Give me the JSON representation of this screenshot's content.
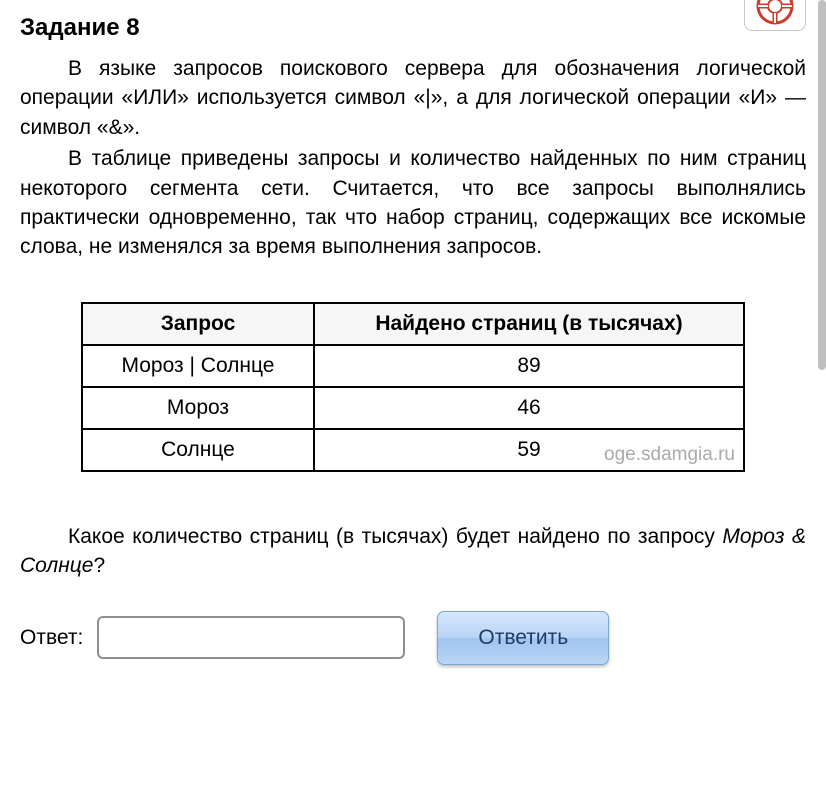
{
  "title": "Задание 8",
  "para1": "В языке запросов поискового сервера для обозначения логической операции «ИЛИ» используется символ «|», а для логической операции «И» — символ «&».",
  "para2": "В таблице приведены запросы и количество найденных по ним страниц некоторого сегмента сети. Считается, что все запросы выполнялись практически одновременно, так что набор страниц, содержащих все искомые слова, не изменялся за время выполнения запросов.",
  "table": {
    "col1": "Запрос",
    "col2": "Найдено страниц (в тысячах)",
    "rows": [
      {
        "q": "Мороз | Солнце",
        "v": "89"
      },
      {
        "q": "Мороз",
        "v": "46"
      },
      {
        "q": "Солнце",
        "v": "59"
      }
    ]
  },
  "watermark": "oge.sdamgia.ru",
  "question1": "Какое количество страниц (в тысячах) будет найдено по запросу ",
  "question_italic": "Мороз & Солнце",
  "question_end": "?",
  "answer_label": "Ответ:",
  "submit_label": "Ответить"
}
